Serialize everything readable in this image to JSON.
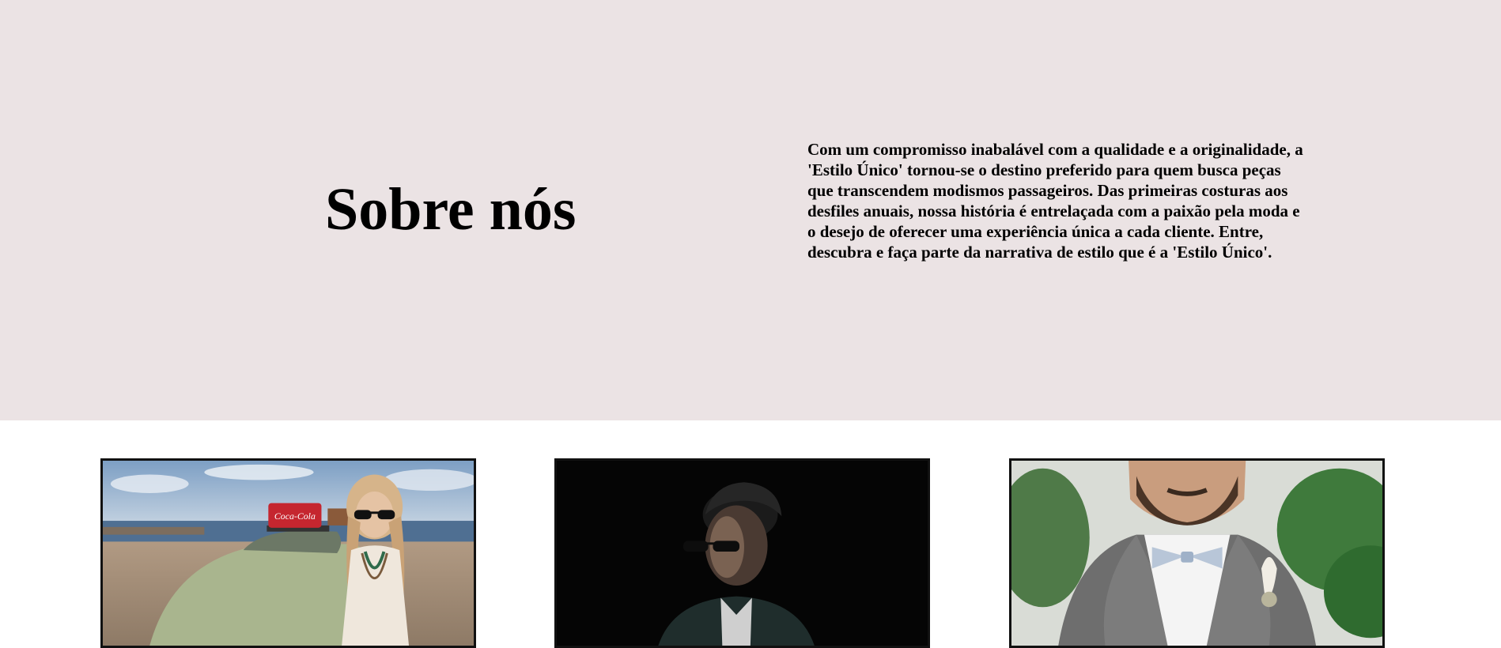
{
  "about": {
    "title": "Sobre nós",
    "text": "Com um compromisso inabalável com a qualidade e a originalidade, a 'Estilo Único' tornou-se o destino preferido para quem busca peças que transcendem modismos passageiros. Das primeiras costuras aos desfiles anuais, nossa história é entrelaçada com a paixão pela moda e o desejo de oferecer uma experiência única a cada cliente. Entre, descubra e faça parte da narrativa de estilo que é a 'Estilo Único'."
  },
  "gallery": {
    "photos": [
      {
        "subject": "woman-with-sunglasses-by-vintage-car-photo",
        "sign_text": "Coca-Cola"
      },
      {
        "subject": "man-with-sunglasses-dark-background-photo"
      },
      {
        "subject": "man-in-suit-with-bow-tie-photo"
      }
    ]
  },
  "colors": {
    "about_bg": "#ebe3e4",
    "page_bg": "#ffffff",
    "card_border": "#111111"
  }
}
